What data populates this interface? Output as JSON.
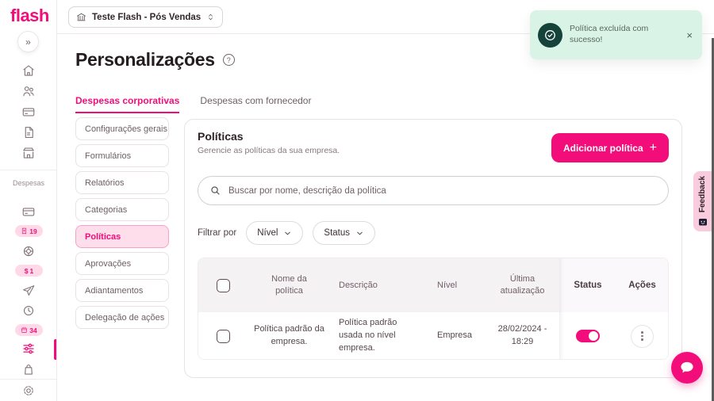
{
  "colors": {
    "accent": "#F20D7A",
    "toast_bg": "#D9F3E6",
    "toast_icon_bg": "#15423A"
  },
  "brand": {
    "logo": "flash"
  },
  "sidebar": {
    "collapse_icon": "»",
    "section_label": "Despesas",
    "badges": [
      {
        "name": "receipts",
        "value": "19"
      },
      {
        "name": "money",
        "symbol": "$",
        "value": "1"
      },
      {
        "name": "calendar",
        "value": "34"
      }
    ]
  },
  "header": {
    "company_selector": "Teste Flash - Pós Vendas"
  },
  "toast": {
    "message": "Política excluída com sucesso!",
    "close_icon": "×"
  },
  "page": {
    "title": "Personalizações",
    "help_icon": "?"
  },
  "tabs": {
    "corporate": "Despesas corporativas",
    "supplier": "Despesas com fornecedor"
  },
  "side_menu": {
    "items": [
      "Configurações gerais",
      "Formulários",
      "Relatórios",
      "Categorias",
      "Políticas",
      "Aprovações",
      "Adiantamentos",
      "Delegação de ações"
    ]
  },
  "panel": {
    "title": "Políticas",
    "subtitle": "Gerencie as políticas da sua empresa.",
    "add_button_label": "Adicionar política",
    "add_button_icon": "+",
    "search_placeholder": "Buscar por nome, descrição da política",
    "filter_label": "Filtrar por",
    "filter_level": "Nível",
    "filter_status": "Status"
  },
  "table": {
    "columns": {
      "name": "Nome da política",
      "description": "Descrição",
      "level": "Nível",
      "updated": "Última atualização",
      "status": "Status",
      "actions": "Ações"
    },
    "rows": [
      {
        "name": "Política padrão da empresa.",
        "description": "Política padrão usada no nível empresa.",
        "level": "Empresa",
        "updated": "28/02/2024 - 18:29"
      }
    ]
  },
  "feedback": {
    "label": "Feedback"
  }
}
